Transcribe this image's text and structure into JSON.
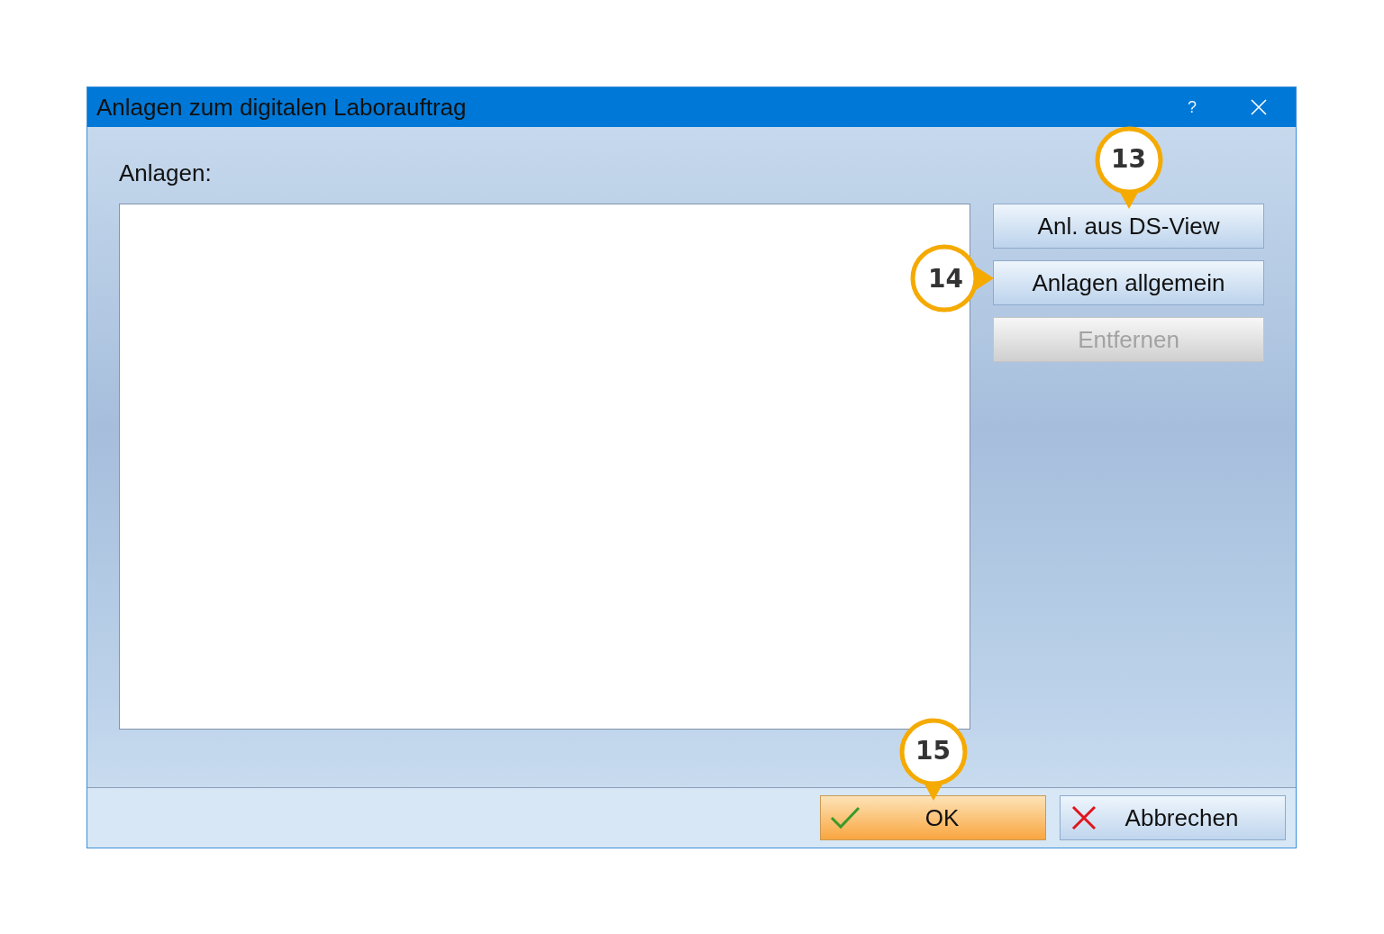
{
  "window": {
    "title": "Anlagen zum digitalen Laborauftrag",
    "help": "?"
  },
  "attachments": {
    "label": "Anlagen:"
  },
  "side_buttons": [
    {
      "label": "Anl. aus DS-View",
      "disabled": false,
      "callout": {
        "number": "13",
        "kind": "above"
      }
    },
    {
      "label": "Anlagen allgemein",
      "disabled": false,
      "callout": {
        "number": "14",
        "kind": "left"
      }
    },
    {
      "label": "Entfernen",
      "disabled": true
    }
  ],
  "footer_buttons": [
    {
      "label": "OK",
      "kind": "ok",
      "callout": {
        "number": "15",
        "kind": "above"
      }
    },
    {
      "label": "Abbrechen",
      "kind": "cancel"
    }
  ]
}
